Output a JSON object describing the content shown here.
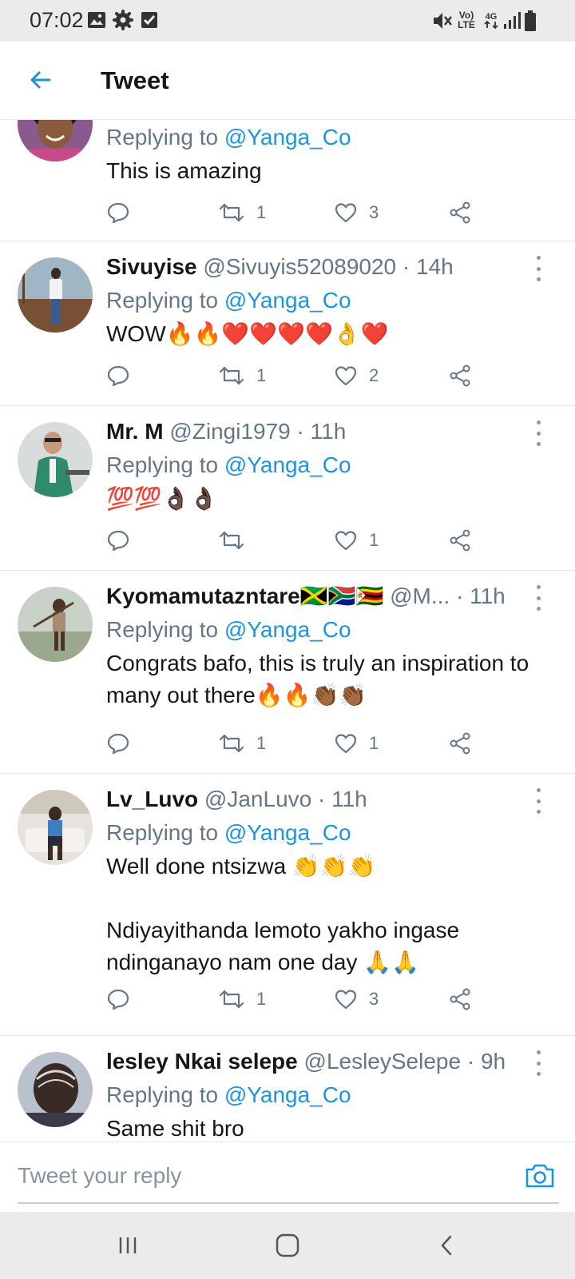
{
  "status_bar": {
    "time": "07:02",
    "left_icons": [
      "image-icon",
      "gear-icon",
      "checkbox-icon"
    ],
    "right_icons": [
      "mute-icon",
      "volte-icon",
      "4g-data-icon",
      "signal-icon",
      "battery-icon"
    ],
    "volte_text": "Vo) LTE",
    "network_text": "4G"
  },
  "header": {
    "title": "Tweet",
    "back_icon": "arrow-left-icon"
  },
  "tweets": [
    {
      "name": "",
      "handle": "",
      "time": "",
      "replying_prefix": "Replying to",
      "replying_to": "@Yanga_Co",
      "text": "This is amazing",
      "retweets": "1",
      "likes": "3"
    },
    {
      "name": "Sivuyise",
      "handle": "@Sivuyis52089020",
      "time": "· 14h",
      "replying_prefix": "Replying to",
      "replying_to": "@Yanga_Co",
      "text": "WOW🔥🔥❤️❤️❤️❤️👌❤️",
      "retweets": "1",
      "likes": "2"
    },
    {
      "name": "Mr. M",
      "handle": "@Zingi1979",
      "time": "· 11h",
      "replying_prefix": "Replying to",
      "replying_to": "@Yanga_Co",
      "text": "💯💯👌🏿👌🏿",
      "retweets": "",
      "likes": "1"
    },
    {
      "name": "Kyomamutazntare🇯🇲🇿🇦🇿🇼",
      "handle": "@M...",
      "time": "· 11h",
      "replying_prefix": "Replying to",
      "replying_to": "@Yanga_Co",
      "text": "Congrats bafo, this is truly an inspiration to many out there🔥🔥👏🏾👏🏾",
      "retweets": "1",
      "likes": "1"
    },
    {
      "name": "Lv_Luvo",
      "handle": "@JanLuvo",
      "time": "· 11h",
      "replying_prefix": "Replying to",
      "replying_to": "@Yanga_Co",
      "text": "Well done ntsizwa 👏👏👏\n\nNdiyayithanda lemoto yakho ingase ndinganayo nam one day 🙏🙏",
      "retweets": "1",
      "likes": "3"
    },
    {
      "name": "lesley Nkai selepe",
      "handle": "@LesleySelepe",
      "time": "· 9h",
      "replying_prefix": "Replying to",
      "replying_to": "@Yanga_Co",
      "text": "Same shit bro",
      "retweets": "",
      "likes": ""
    }
  ],
  "action_icons": [
    "reply-icon",
    "retweet-icon",
    "like-icon",
    "share-icon"
  ],
  "reply_bar": {
    "placeholder": "Tweet your reply",
    "camera_icon": "camera-icon"
  },
  "nav_bar": {
    "icons": [
      "recent-apps-icon",
      "home-icon",
      "back-icon"
    ]
  },
  "colors": {
    "accent": "#1b95e0",
    "secondary_text": "#657786",
    "primary_text": "#14171a",
    "system_bar": "#ebebeb"
  }
}
